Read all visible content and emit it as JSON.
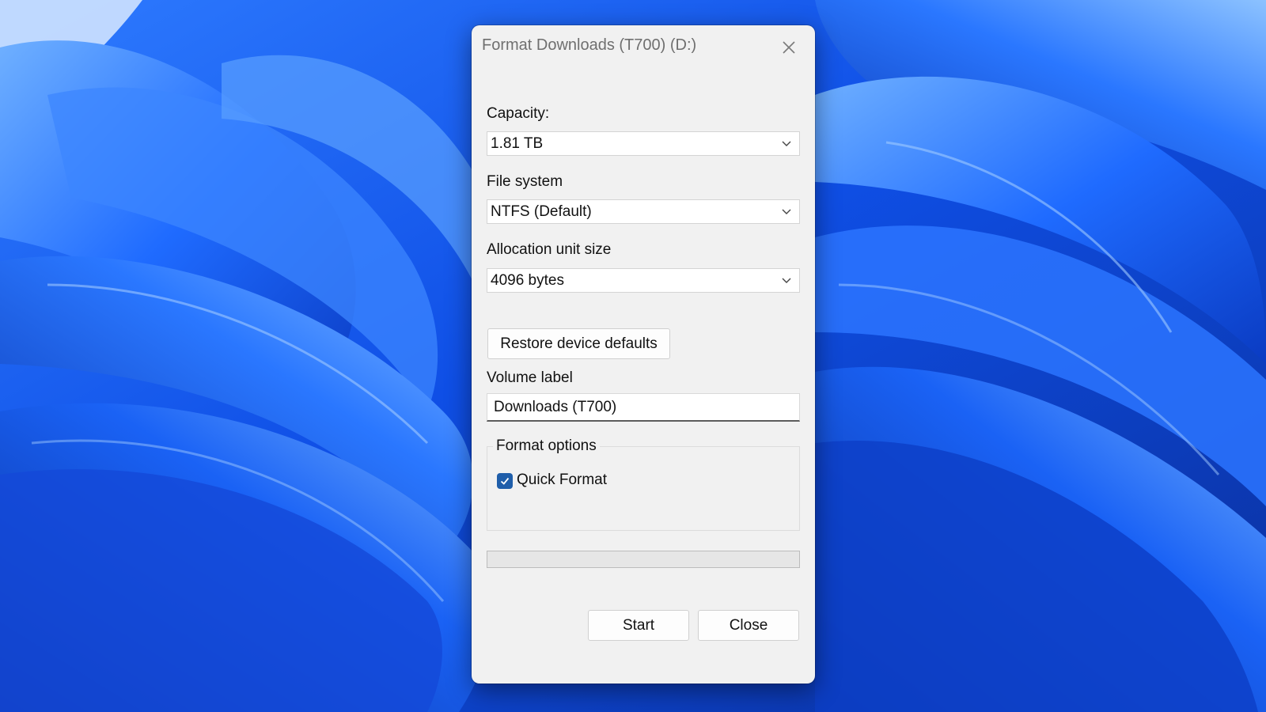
{
  "dialog": {
    "title": "Format Downloads (T700) (D:)"
  },
  "capacity": {
    "label": "Capacity:",
    "value": "1.81 TB"
  },
  "file_system": {
    "label": "File system",
    "value": "NTFS (Default)"
  },
  "allocation": {
    "label": "Allocation unit size",
    "value": "4096 bytes"
  },
  "restore_defaults_label": "Restore device defaults",
  "volume": {
    "label": "Volume label",
    "value": "Downloads (T700)"
  },
  "format_options": {
    "title": "Format options",
    "quick_format_label": "Quick Format",
    "quick_format_checked": true
  },
  "progress": {
    "fraction": 0
  },
  "buttons": {
    "start": "Start",
    "close": "Close"
  },
  "icons": {
    "close": "close-icon",
    "dropdown": "chevron-down-icon",
    "check": "checkmark-icon"
  },
  "colors": {
    "dialog_bg": "#f1f1f1",
    "checkbox_accent": "#1f5eaa",
    "wallpaper_blue": "#0a3fd6"
  }
}
